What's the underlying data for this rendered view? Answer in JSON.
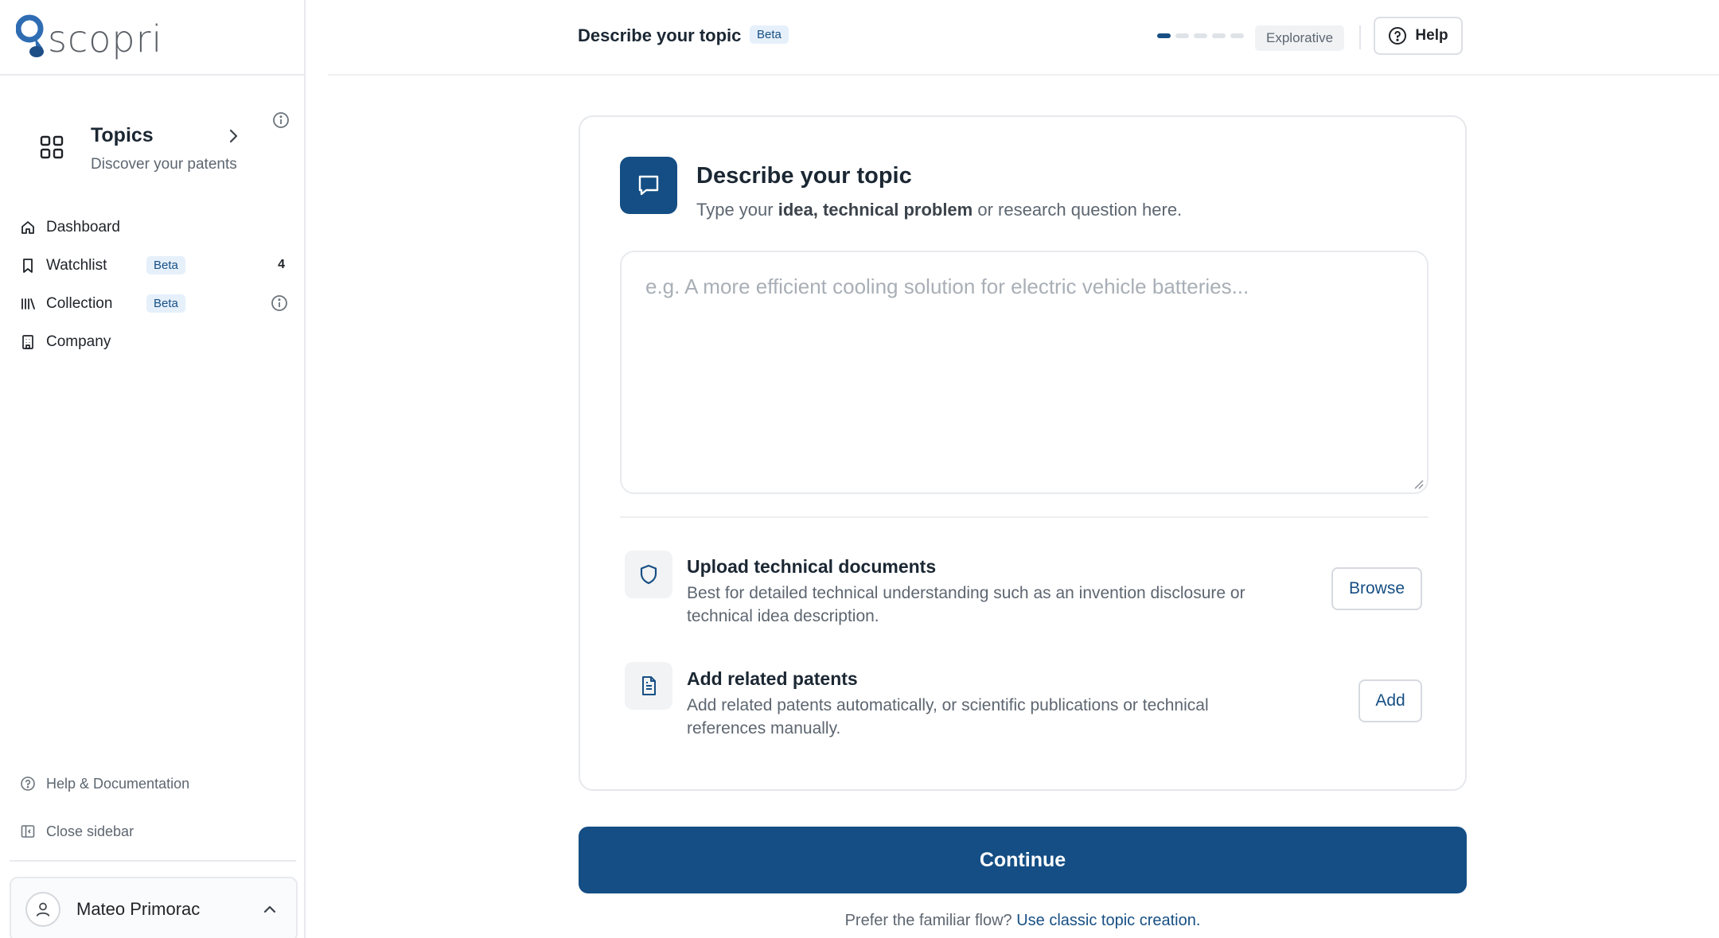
{
  "brand": {
    "logo_text": "scopri"
  },
  "sidebar": {
    "topics": {
      "title": "Topics",
      "subtitle": "Discover your patents"
    },
    "items": [
      {
        "label": "Dashboard",
        "icon": "home-icon"
      },
      {
        "label": "Watchlist",
        "icon": "bookmark-icon",
        "badge": "Beta",
        "count": "4"
      },
      {
        "label": "Collection",
        "icon": "library-icon",
        "badge": "Beta"
      },
      {
        "label": "Company",
        "icon": "building-icon"
      }
    ],
    "bottom_links": [
      {
        "label": "Help & Documentation",
        "icon": "help-circle-icon"
      },
      {
        "label": "Close sidebar",
        "icon": "sidebar-collapse-icon"
      }
    ],
    "user": {
      "name": "Mateo Primorac"
    }
  },
  "header": {
    "title": "Describe your topic",
    "badge": "Beta",
    "progress": {
      "current_step": 1,
      "total_steps": 5
    },
    "mode": "Explorative",
    "help_label": "Help"
  },
  "card": {
    "title": "Describe your topic",
    "subtitle": {
      "prefix": "Type your ",
      "bold": "idea, technical problem",
      "suffix": " or research question here."
    },
    "input": {
      "value": "",
      "placeholder": "e.g. A more efficient cooling solution for electric vehicle batteries..."
    },
    "options": [
      {
        "title": "Upload technical documents",
        "description": "Best for detailed technical understanding such as an invention disclosure or technical idea description.",
        "button": "Browse",
        "icon": "shield-icon"
      },
      {
        "title": "Add related patents",
        "description": "Add related patents automatically, or scientific publications or technical references manually.",
        "button": "Add",
        "icon": "document-icon"
      }
    ]
  },
  "continue_label": "Continue",
  "footer": {
    "prompt": "Prefer the familiar flow?",
    "link": "Use classic topic creation."
  },
  "colors": {
    "primary": "#144e84",
    "badge_bg": "#e6f0fb",
    "muted_text": "#5d6670"
  }
}
